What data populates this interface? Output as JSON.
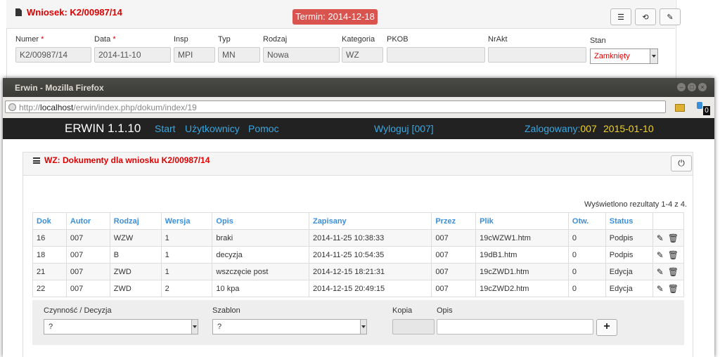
{
  "background": {
    "title": "Wniosek: K2/00987/14",
    "termin": "Termin: 2014-12-18",
    "fields": [
      {
        "label": "Numer",
        "required": true,
        "value": "K2/00987/14"
      },
      {
        "label": "Data",
        "required": true,
        "value": "2014-11-10"
      },
      {
        "label": "Insp",
        "required": false,
        "value": "MPI"
      },
      {
        "label": "Typ",
        "required": false,
        "value": "MN"
      },
      {
        "label": "Rodzaj",
        "required": false,
        "value": "Nowa"
      },
      {
        "label": "Kategoria",
        "required": false,
        "value": "WZ"
      },
      {
        "label": "PKOB",
        "required": false,
        "value": ""
      },
      {
        "label": "NrAkt",
        "required": false,
        "value": ""
      },
      {
        "label": "Stan",
        "required": false,
        "value": "Zamknięty"
      }
    ],
    "required_mark": "*"
  },
  "window": {
    "title": "Erwin - Mozilla Firefox",
    "url_prefix": "http://",
    "url_host": "localhost",
    "url_path": "/erwin/index.php/dokum/index/19",
    "ext_badge": "0"
  },
  "app": {
    "brand": "ERWIN 1.1.10",
    "nav": [
      "Start",
      "Użytkownicy",
      "Pomoc"
    ],
    "logout": "Wyloguj [007]",
    "logged_label": "Zalogowany:",
    "logged_user": "007",
    "date": "2015-01-10"
  },
  "panel": {
    "title": "WZ: Dokumenty dla wniosku K2/00987/14",
    "count_text": "Wyświetlono rezultaty 1-4 z 4."
  },
  "table": {
    "headers": [
      "Dok",
      "Autor",
      "Rodzaj",
      "Wersja",
      "Opis",
      "Zapisany",
      "Przez",
      "Plik",
      "Otw.",
      "Status",
      ""
    ],
    "rows": [
      [
        "16",
        "007",
        "WZW",
        "1",
        "braki",
        "2014-11-25 10:38:33",
        "007",
        "19cWZW1.htm",
        "0",
        "Podpis"
      ],
      [
        "18",
        "007",
        "B",
        "1",
        "decyzja",
        "2014-11-25 10:54:35",
        "007",
        "19dB1.htm",
        "0",
        "Podpis"
      ],
      [
        "21",
        "007",
        "ZWD",
        "1",
        "wszczęcie post",
        "2014-12-15 18:21:31",
        "007",
        "19cZWD1.htm",
        "0",
        "Edycja"
      ],
      [
        "22",
        "007",
        "ZWD",
        "2",
        "10 kpa",
        "2014-12-15 20:49:15",
        "007",
        "19cZWD2.htm",
        "0",
        "Edycja"
      ]
    ]
  },
  "form": {
    "czynnosc_label": "Czynność / Decyzja",
    "czynnosc_value": "?",
    "szablon_label": "Szablon",
    "szablon_value": "?",
    "kopia_label": "Kopia",
    "opis_label": "Opis",
    "add_label": "+"
  }
}
